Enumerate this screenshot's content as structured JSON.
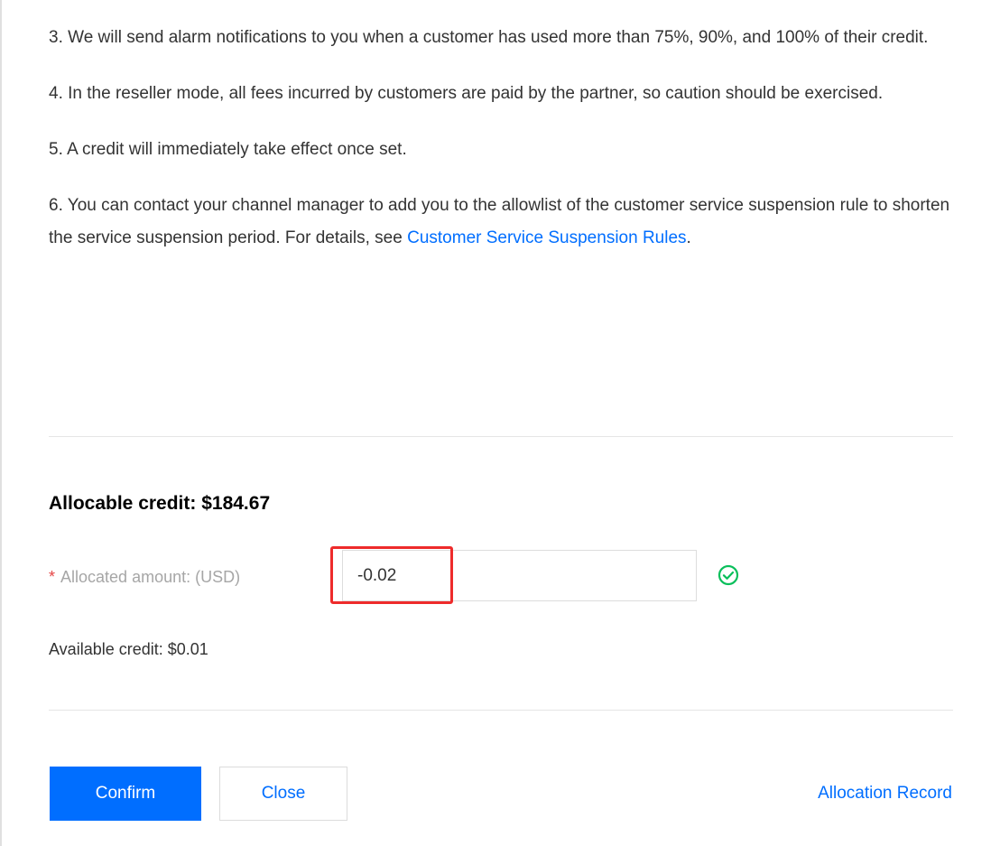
{
  "notes": {
    "item3": "3. We will send alarm notifications to you when a customer has used more than 75%, 90%, and 100% of their credit.",
    "item4": "4. In the reseller mode, all fees incurred by customers are paid by the partner, so caution should be exercised.",
    "item5": "5. A credit will immediately take effect once set.",
    "item6_text": "6. You can contact your channel manager to add you to the allowlist of the customer service suspension rule to shorten the service suspension period. For details, see ",
    "item6_link": "Customer Service Suspension Rules",
    "item6_end": "."
  },
  "credit": {
    "title": "Allocable credit: $184.67",
    "required_mark": "*",
    "amount_label": "Allocated amount: (USD)",
    "amount_value": "-0.02",
    "available": "Available credit: $0.01"
  },
  "actions": {
    "confirm_label": "Confirm",
    "close_label": "Close",
    "record_label": "Allocation Record"
  },
  "icons": {
    "valid": "check-circle-icon"
  },
  "colors": {
    "primary": "#006eff",
    "success": "#0abf5b",
    "highlight": "#ee2b2b",
    "required": "#e54545"
  }
}
